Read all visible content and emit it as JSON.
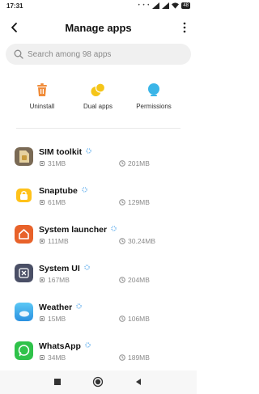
{
  "status_bar": {
    "time": "17:31",
    "dots": "• • •",
    "battery": "48"
  },
  "header": {
    "title": "Manage apps"
  },
  "search": {
    "placeholder": "Search among 98 apps"
  },
  "actions": [
    {
      "label": "Uninstall",
      "icon": "trash-icon",
      "color": "#f08c3a"
    },
    {
      "label": "Dual apps",
      "icon": "dual-circles-icon",
      "color": "#f5c518"
    },
    {
      "label": "Permissions",
      "icon": "shield-icon",
      "color": "#3ab5e8"
    }
  ],
  "apps": [
    {
      "name": "SIM toolkit",
      "size": "31MB",
      "cache": "201MB",
      "icon": "sim-card-icon"
    },
    {
      "name": "Snaptube",
      "size": "61MB",
      "cache": "129MB",
      "icon": "snaptube-icon"
    },
    {
      "name": "System launcher",
      "size": "111MB",
      "cache": "30.24MB",
      "icon": "home-icon"
    },
    {
      "name": "System UI",
      "size": "167MB",
      "cache": "204MB",
      "icon": "system-ui-icon"
    },
    {
      "name": "Weather",
      "size": "15MB",
      "cache": "106MB",
      "icon": "weather-icon"
    },
    {
      "name": "WhatsApp",
      "size": "34MB",
      "cache": "189MB",
      "icon": "whatsapp-icon"
    }
  ],
  "colors": {
    "accent": "#3a9ae8",
    "muted": "#8a8a8a"
  }
}
